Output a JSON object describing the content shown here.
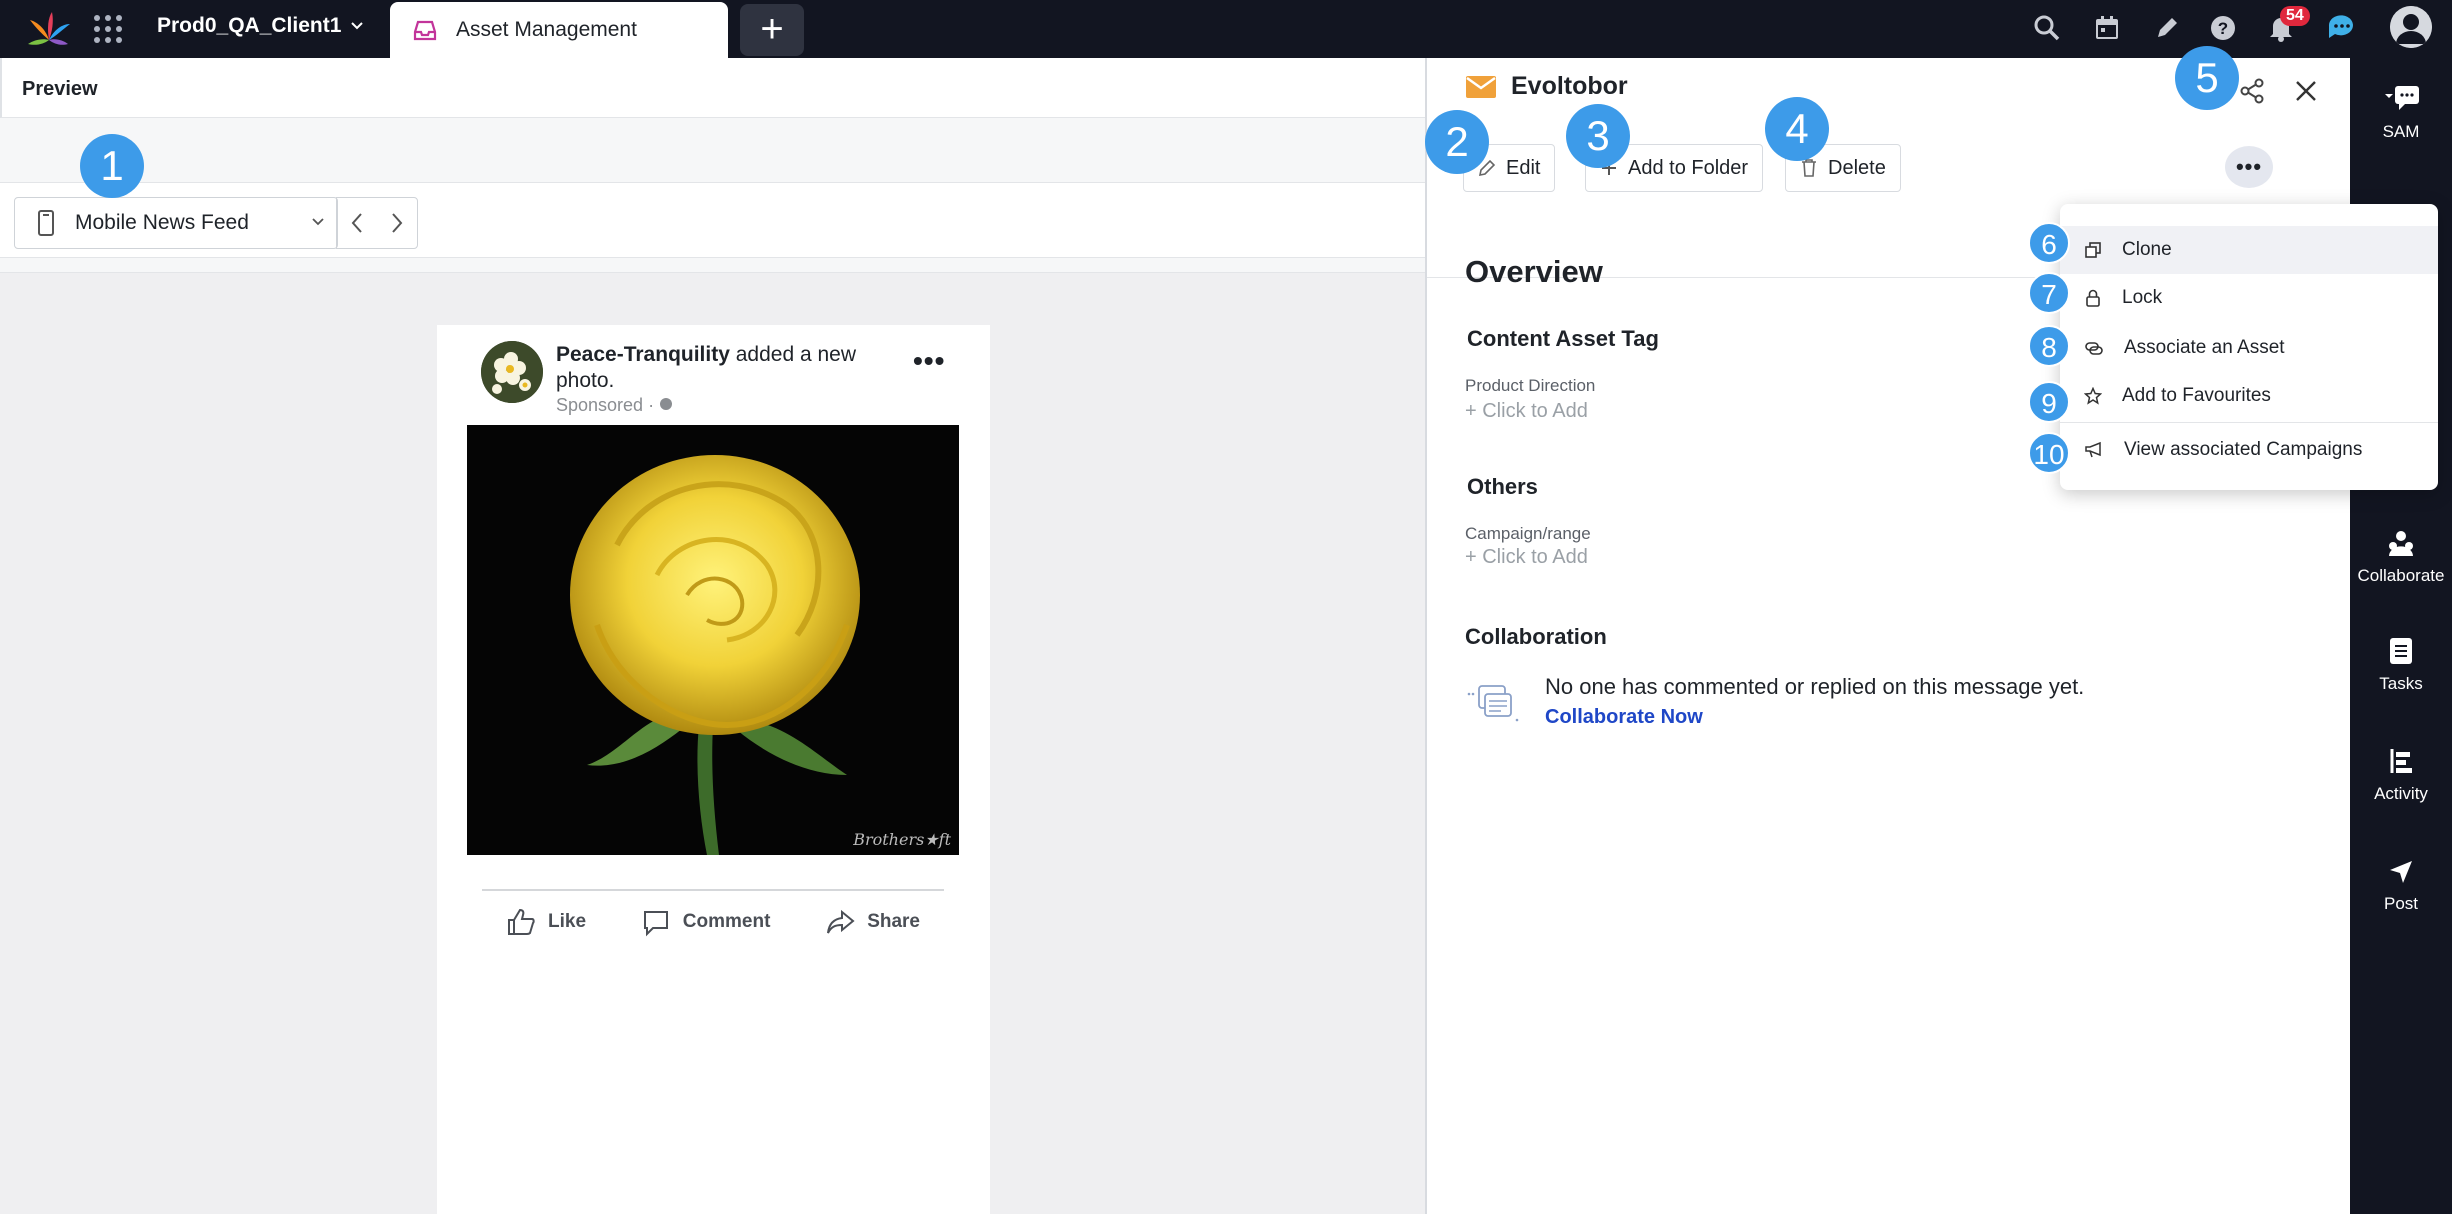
{
  "topbar": {
    "workspace": "Prod0_QA_Client1",
    "active_tab": "Asset Management",
    "add_tab": "+",
    "notification_count": "54"
  },
  "preview": {
    "header": "Preview",
    "placement_select": "Mobile News Feed"
  },
  "post": {
    "page_name": "Peace-Tranquility",
    "action_text": " added a new photo.",
    "sponsored": "Sponsored · ",
    "more": "•••",
    "like": "Like",
    "comment": "Comment",
    "share": "Share",
    "watermark": "Brothers★ft"
  },
  "panel": {
    "title": "Evoltobor",
    "edit": "Edit",
    "add_to_folder": "Add to Folder",
    "delete": "Delete",
    "more": "•••",
    "overview": "Overview",
    "content_asset_tag": "Content Asset Tag",
    "product_direction_label": "Product Direction",
    "product_direction_value": "+ Click to Add",
    "others": "Others",
    "campaign_label": "Campaign/range",
    "campaign_value": "+ Click to Add",
    "collaboration": "Collaboration",
    "no_comments": "No one has commented or replied on this message yet.",
    "collaborate_now": "Collaborate Now"
  },
  "dropdown": {
    "items": [
      {
        "label": "Clone",
        "icon": "clone-icon"
      },
      {
        "label": "Lock",
        "icon": "lock-icon"
      },
      {
        "label": "Associate an Asset",
        "icon": "link-icon"
      },
      {
        "label": "Add to Favourites",
        "icon": "star-icon"
      },
      {
        "label": "View associated Campaigns",
        "icon": "megaphone-icon"
      }
    ]
  },
  "rail": {
    "sam": "SAM",
    "collaborate": "Collaborate",
    "tasks": "Tasks",
    "activity": "Activity",
    "post": "Post"
  },
  "callouts": [
    "1",
    "2",
    "3",
    "4",
    "5",
    "6",
    "7",
    "8",
    "9",
    "10"
  ],
  "colors": {
    "topbar": "#121521",
    "callout": "#3d9be9",
    "link": "#1f47c7",
    "badge": "#e0283d",
    "mail_icon": "#f0a13a"
  }
}
